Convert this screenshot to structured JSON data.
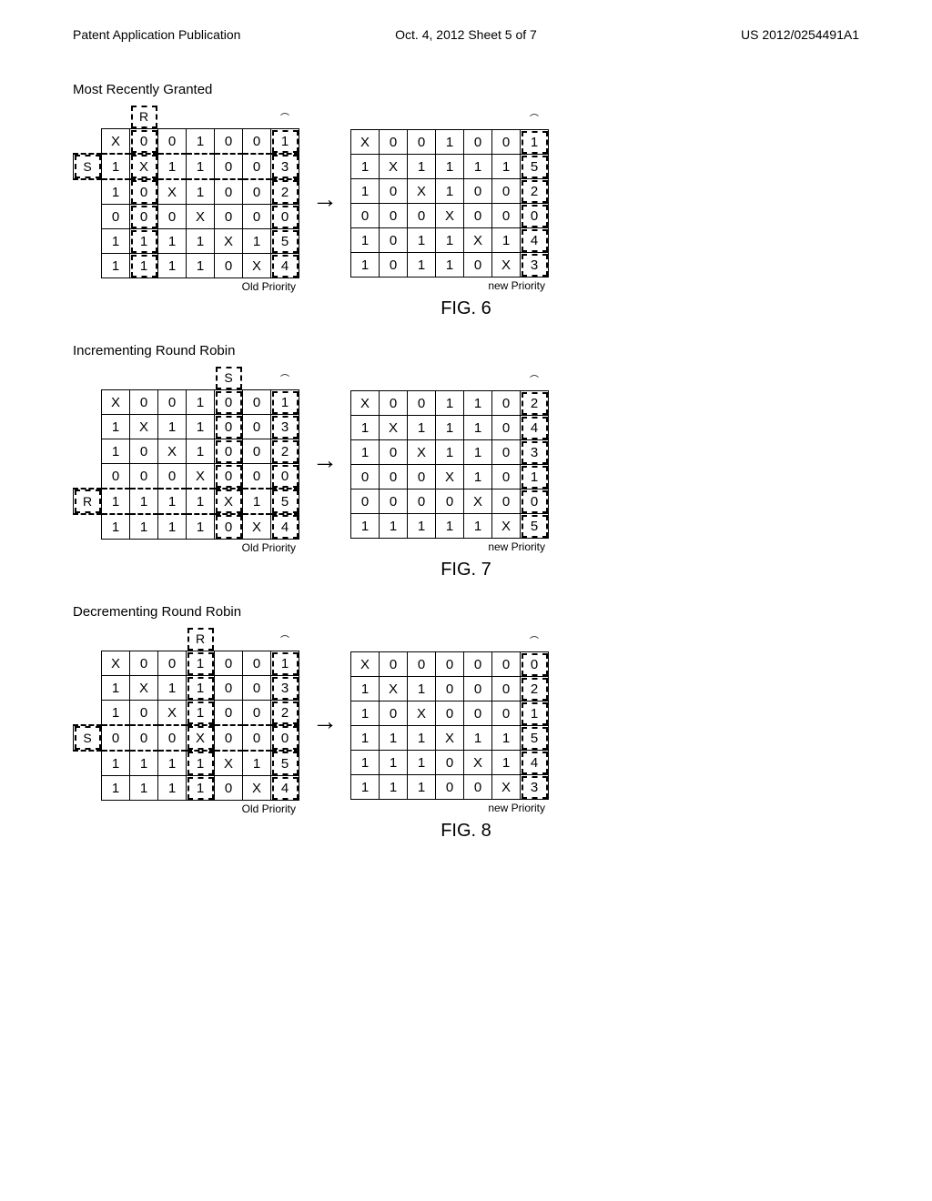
{
  "header": {
    "left": "Patent Application Publication",
    "center": "Oct. 4, 2012  Sheet 5 of 7",
    "right": "US 2012/0254491A1"
  },
  "titles": {
    "s1": "Most Recently Granted",
    "s2": "Incrementing Round Robin",
    "s3": "Decrementing Round Robin"
  },
  "captions": {
    "old": "Old Priority",
    "new": "new Priority"
  },
  "figs": {
    "f6": "FIG. 6",
    "f7": "FIG. 7",
    "f8": "FIG. 8"
  },
  "marks": {
    "R": "R",
    "S": "S",
    "X": "X",
    "arrow": "→"
  },
  "chart_data": [
    {
      "type": "table",
      "title": "Most Recently Granted",
      "fig": "FIG. 6",
      "left": {
        "col_header": {
          "index": 1,
          "label": "R"
        },
        "row_header": {
          "index": 1,
          "label": "S"
        },
        "rows": [
          [
            "X",
            "0",
            "0",
            "1",
            "0",
            "0",
            "1"
          ],
          [
            "1",
            "X",
            "1",
            "1",
            "0",
            "0",
            "3"
          ],
          [
            "1",
            "0",
            "X",
            "1",
            "0",
            "0",
            "2"
          ],
          [
            "0",
            "0",
            "0",
            "X",
            "0",
            "0",
            "0"
          ],
          [
            "1",
            "1",
            "1",
            "1",
            "X",
            "1",
            "5"
          ],
          [
            "1",
            "1",
            "1",
            "1",
            "0",
            "X",
            "4"
          ]
        ],
        "caption": "Old Priority"
      },
      "right": {
        "rows": [
          [
            "X",
            "0",
            "0",
            "1",
            "0",
            "0",
            "1"
          ],
          [
            "1",
            "X",
            "1",
            "1",
            "1",
            "1",
            "5"
          ],
          [
            "1",
            "0",
            "X",
            "1",
            "0",
            "0",
            "2"
          ],
          [
            "0",
            "0",
            "0",
            "X",
            "0",
            "0",
            "0"
          ],
          [
            "1",
            "0",
            "1",
            "1",
            "X",
            "1",
            "4"
          ],
          [
            "1",
            "0",
            "1",
            "1",
            "0",
            "X",
            "3"
          ]
        ],
        "caption": "new Priority"
      }
    },
    {
      "type": "table",
      "title": "Incrementing Round Robin",
      "fig": "FIG. 7",
      "left": {
        "col_header": {
          "index": 4,
          "label": "S"
        },
        "row_header": {
          "index": 4,
          "label": "R"
        },
        "rows": [
          [
            "X",
            "0",
            "0",
            "1",
            "0",
            "0",
            "1"
          ],
          [
            "1",
            "X",
            "1",
            "1",
            "0",
            "0",
            "3"
          ],
          [
            "1",
            "0",
            "X",
            "1",
            "0",
            "0",
            "2"
          ],
          [
            "0",
            "0",
            "0",
            "X",
            "0",
            "0",
            "0"
          ],
          [
            "1",
            "1",
            "1",
            "1",
            "X",
            "1",
            "5"
          ],
          [
            "1",
            "1",
            "1",
            "1",
            "0",
            "X",
            "4"
          ]
        ],
        "caption": "Old Priority"
      },
      "right": {
        "rows": [
          [
            "X",
            "0",
            "0",
            "1",
            "1",
            "0",
            "2"
          ],
          [
            "1",
            "X",
            "1",
            "1",
            "1",
            "0",
            "4"
          ],
          [
            "1",
            "0",
            "X",
            "1",
            "1",
            "0",
            "3"
          ],
          [
            "0",
            "0",
            "0",
            "X",
            "1",
            "0",
            "1"
          ],
          [
            "0",
            "0",
            "0",
            "0",
            "X",
            "0",
            "0"
          ],
          [
            "1",
            "1",
            "1",
            "1",
            "1",
            "X",
            "5"
          ]
        ],
        "caption": "new Priority"
      }
    },
    {
      "type": "table",
      "title": "Decrementing Round Robin",
      "fig": "FIG. 8",
      "left": {
        "col_header": {
          "index": 3,
          "label": "R"
        },
        "row_header": {
          "index": 3,
          "label": "S"
        },
        "rows": [
          [
            "X",
            "0",
            "0",
            "1",
            "0",
            "0",
            "1"
          ],
          [
            "1",
            "X",
            "1",
            "1",
            "0",
            "0",
            "3"
          ],
          [
            "1",
            "0",
            "X",
            "1",
            "0",
            "0",
            "2"
          ],
          [
            "0",
            "0",
            "0",
            "X",
            "0",
            "0",
            "0"
          ],
          [
            "1",
            "1",
            "1",
            "1",
            "X",
            "1",
            "5"
          ],
          [
            "1",
            "1",
            "1",
            "1",
            "0",
            "X",
            "4"
          ]
        ],
        "caption": "Old Priority"
      },
      "right": {
        "rows": [
          [
            "X",
            "0",
            "0",
            "0",
            "0",
            "0",
            "0"
          ],
          [
            "1",
            "X",
            "1",
            "0",
            "0",
            "0",
            "2"
          ],
          [
            "1",
            "0",
            "X",
            "0",
            "0",
            "0",
            "1"
          ],
          [
            "1",
            "1",
            "1",
            "X",
            "1",
            "1",
            "5"
          ],
          [
            "1",
            "1",
            "1",
            "0",
            "X",
            "1",
            "4"
          ],
          [
            "1",
            "1",
            "1",
            "0",
            "0",
            "X",
            "3"
          ]
        ],
        "caption": "new Priority"
      }
    }
  ]
}
